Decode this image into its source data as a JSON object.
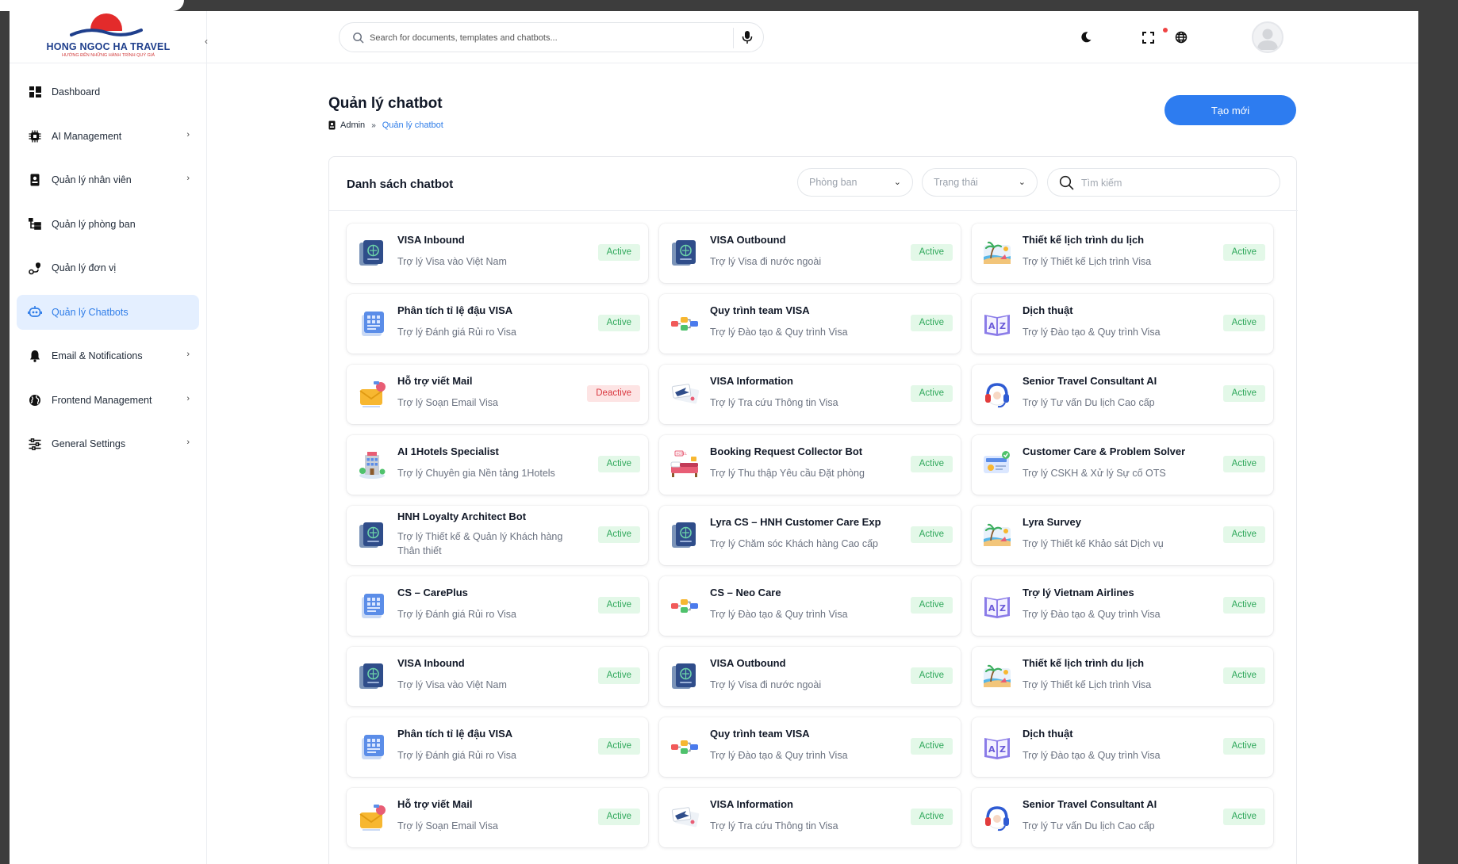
{
  "brand": {
    "title": "HONG NGOC HA TRAVEL",
    "tagline": "HƯỚNG ĐẾN NHỮNG HÀNH TRÌNH QUÝ GIÁ"
  },
  "sidebar": {
    "items": [
      {
        "label": "Dashboard",
        "icon": "dashboard-icon",
        "chevron": false,
        "active": false
      },
      {
        "label": "AI Management",
        "icon": "chip-icon",
        "chevron": true,
        "active": false
      },
      {
        "label": "Quản lý nhân viên",
        "icon": "id-badge-icon",
        "chevron": true,
        "active": false
      },
      {
        "label": "Quản lý phòng ban",
        "icon": "hierarchy-icon",
        "chevron": false,
        "active": false
      },
      {
        "label": "Quản lý đơn vị",
        "icon": "route-icon",
        "chevron": false,
        "active": false
      },
      {
        "label": "Quản lý Chatbots",
        "icon": "bot-icon",
        "chevron": false,
        "active": true
      },
      {
        "label": "Email & Notifications",
        "icon": "bell-icon",
        "chevron": true,
        "active": false
      },
      {
        "label": "Frontend Management",
        "icon": "globe-icon",
        "chevron": true,
        "active": false
      },
      {
        "label": "General Settings",
        "icon": "sliders-icon",
        "chevron": true,
        "active": false
      }
    ]
  },
  "header": {
    "search_placeholder": "Search for documents, templates and chatbots..."
  },
  "page": {
    "title": "Quản lý chatbot",
    "breadcrumb_root": "Admin",
    "breadcrumb_current": "Quản lý chatbot",
    "create_label": "Tạo mới"
  },
  "panel": {
    "title": "Danh sách chatbot",
    "filter_department": "Phòng ban",
    "filter_status": "Trạng thái",
    "search_placeholder": "Tìm kiếm"
  },
  "colors": {
    "accent": "#2d7cf0",
    "active_bg": "#e3f8e8",
    "active_text": "#2fa85b",
    "deactive_bg": "#fde4e4",
    "deactive_text": "#d9363e"
  },
  "chatbots": [
    {
      "name": "VISA Inbound",
      "desc": "Trợ lý Visa vào Việt Nam",
      "status": "Active",
      "icon": "passport-icon"
    },
    {
      "name": "VISA Outbound",
      "desc": "Trợ lý Visa đi nước ngoài",
      "status": "Active",
      "icon": "passport-icon"
    },
    {
      "name": "Thiết kế lịch trình du lịch",
      "desc": "Trợ lý Thiết kế Lịch trình Visa",
      "status": "Active",
      "icon": "beach-icon"
    },
    {
      "name": "Phân tích tỉ lệ đậu VISA",
      "desc": "Trợ lý Đánh giá Rủi ro Visa",
      "status": "Active",
      "icon": "document-icon"
    },
    {
      "name": "Quy trình team VISA",
      "desc": "Trợ lý Đào tạo & Quy trình Visa",
      "status": "Active",
      "icon": "workflow-icon"
    },
    {
      "name": "Dịch thuật",
      "desc": "Trợ lý Đào tạo & Quy trình Visa",
      "status": "Active",
      "icon": "translate-book-icon"
    },
    {
      "name": "Hỗ trợ viết Mail",
      "desc": "Trợ lý Soạn Email Visa",
      "status": "Deactive",
      "icon": "mail-icon"
    },
    {
      "name": "VISA Information",
      "desc": "Trợ lý Tra cứu Thông tin Visa",
      "status": "Active",
      "icon": "plane-ticket-icon"
    },
    {
      "name": "Senior Travel Consultant AI",
      "desc": "Trợ lý Tư vấn Du lịch Cao cấp",
      "status": "Active",
      "icon": "headset-icon"
    },
    {
      "name": "AI 1Hotels Specialist",
      "desc": "Trợ lý Chuyên gia Nền tảng 1Hotels",
      "status": "Active",
      "icon": "hotel-icon"
    },
    {
      "name": "Booking Request Collector Bot",
      "desc": "Trợ lý Thu thập Yêu cầu Đặt phòng",
      "status": "Active",
      "icon": "bed-icon"
    },
    {
      "name": "Customer Care & Problem Solver",
      "desc": "Trợ lý CSKH & Xử lý Sự cố OTS",
      "status": "Active",
      "icon": "support-icon"
    },
    {
      "name": "HNH Loyalty Architect Bot",
      "desc": "Trợ lý Thiết kế & Quản lý Khách hàng Thân thiết",
      "status": "Active",
      "icon": "passport-icon"
    },
    {
      "name": "Lyra CS – HNH Customer Care Exp",
      "desc": "Trợ lý Chăm sóc Khách hàng Cao cấp",
      "status": "Active",
      "icon": "passport-icon"
    },
    {
      "name": "Lyra Survey",
      "desc": "Trợ lý Thiết kế Khảo sát Dịch vụ",
      "status": "Active",
      "icon": "beach-icon"
    },
    {
      "name": "CS – CarePlus",
      "desc": "Trợ lý Đánh giá Rủi ro Visa",
      "status": "Active",
      "icon": "document-icon"
    },
    {
      "name": "CS – Neo Care",
      "desc": "Trợ lý Đào tạo & Quy trình Visa",
      "status": "Active",
      "icon": "workflow-icon"
    },
    {
      "name": "Trợ lý Vietnam Airlines",
      "desc": "Trợ lý Đào tạo & Quy trình Visa",
      "status": "Active",
      "icon": "translate-book-icon"
    },
    {
      "name": "VISA Inbound",
      "desc": "Trợ lý Visa vào Việt Nam",
      "status": "Active",
      "icon": "passport-icon"
    },
    {
      "name": "VISA Outbound",
      "desc": "Trợ lý Visa đi nước ngoài",
      "status": "Active",
      "icon": "passport-icon"
    },
    {
      "name": "Thiết kế lịch trình du lịch",
      "desc": "Trợ lý Thiết kế Lịch trình Visa",
      "status": "Active",
      "icon": "beach-icon"
    },
    {
      "name": "Phân tích tỉ lệ đậu VISA",
      "desc": "Trợ lý Đánh giá Rủi ro Visa",
      "status": "Active",
      "icon": "document-icon"
    },
    {
      "name": "Quy trình team VISA",
      "desc": "Trợ lý Đào tạo & Quy trình Visa",
      "status": "Active",
      "icon": "workflow-icon"
    },
    {
      "name": "Dịch thuật",
      "desc": "Trợ lý Đào tạo & Quy trình Visa",
      "status": "Active",
      "icon": "translate-book-icon"
    },
    {
      "name": "Hỗ trợ viết Mail",
      "desc": "Trợ lý Soạn Email Visa",
      "status": "Active",
      "icon": "mail-icon"
    },
    {
      "name": "VISA Information",
      "desc": "Trợ lý Tra cứu Thông tin Visa",
      "status": "Active",
      "icon": "plane-ticket-icon"
    },
    {
      "name": "Senior Travel Consultant AI",
      "desc": "Trợ lý Tư vấn Du lịch Cao cấp",
      "status": "Active",
      "icon": "headset-icon"
    }
  ]
}
